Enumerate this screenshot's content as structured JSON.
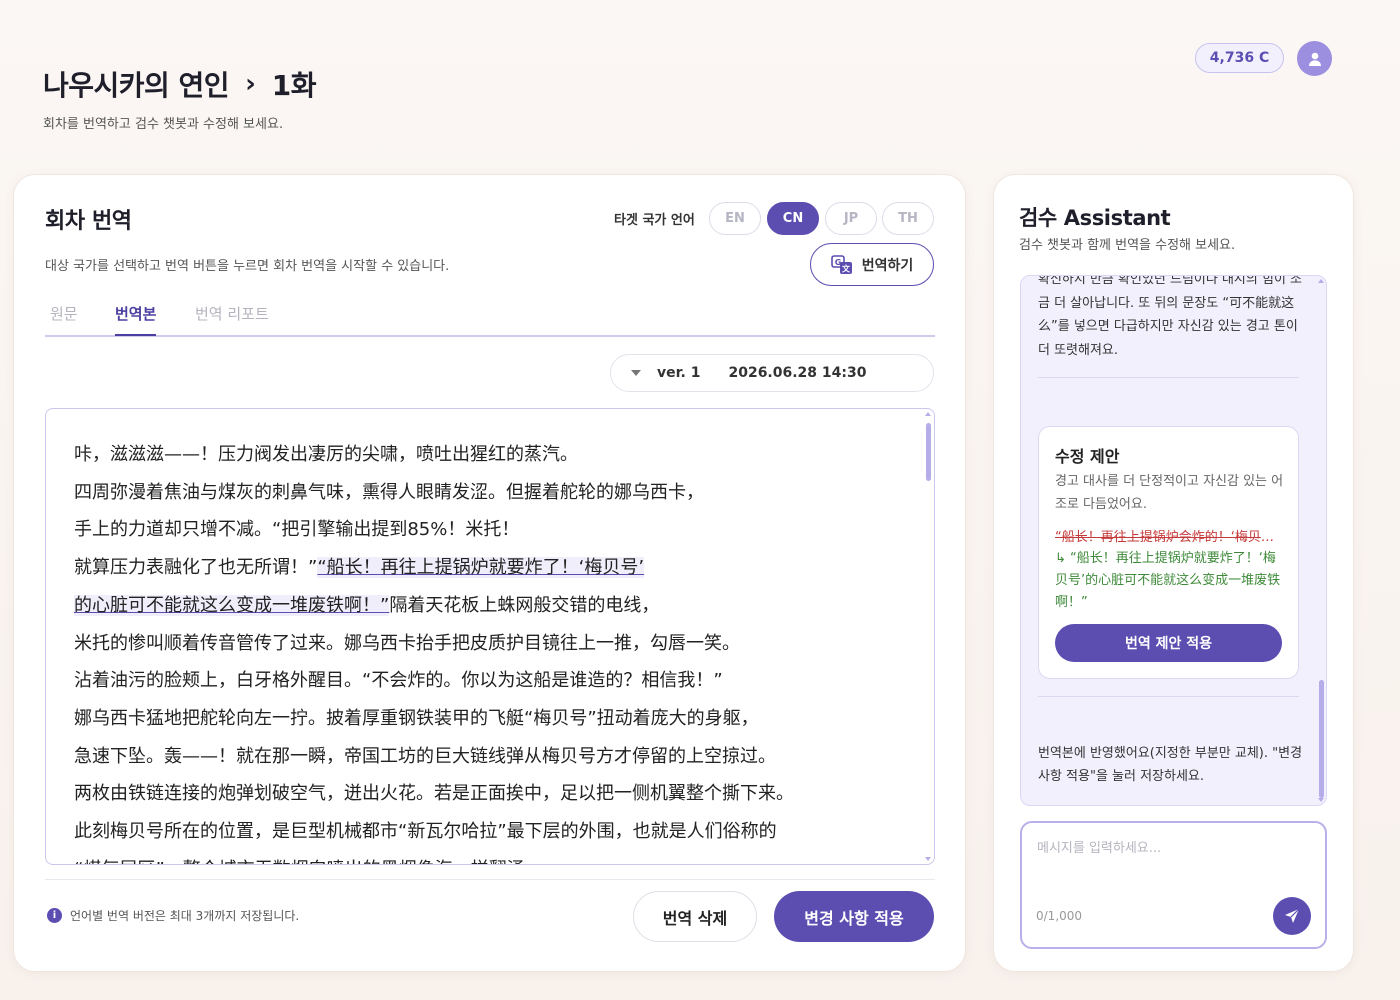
{
  "header": {
    "breadcrumb_work": "나우시카의 연인",
    "breadcrumb_episode": "1화",
    "subtitle": "회차를 번역하고 검수 챗봇과 수정해 보세요.",
    "credits": "4,736 C"
  },
  "translation_panel": {
    "title": "회차 번역",
    "description": "대상 국가를 선택하고 번역 버튼을 누르면 회차 번역을 시작할 수 있습니다.",
    "target_language_label": "타겟 국가 언어",
    "languages": [
      {
        "code": "EN",
        "active": false
      },
      {
        "code": "CN",
        "active": true
      },
      {
        "code": "JP",
        "active": false
      },
      {
        "code": "TH",
        "active": false
      }
    ],
    "translate_button": "번역하기",
    "tabs": [
      {
        "label": "원문",
        "active": false
      },
      {
        "label": "번역본",
        "active": true
      },
      {
        "label": "번역 리포트",
        "active": false
      }
    ],
    "version": {
      "label": "ver. 1",
      "date": "2026.06.28 14:30"
    },
    "text_lines": [
      "咔，滋滋滋——！压力阀发出凄厉的尖啸，喷吐出猩红的蒸汽。",
      "四周弥漫着焦油与煤灰的刺鼻气味，熏得人眼睛发涩。但握着舵轮的娜乌西卡，",
      "手上的力道却只增不减。“把引擎输出提到85%！米托！",
      "就算压力表融化了也无所谓！”",
      "“船长！再往上提锅炉就要炸了！‘梅贝号’",
      "的心脏可不能就这么变成一堆废铁啊！”",
      "隔着天花板上蛛网般交错的电线，",
      "米托的惨叫顺着传音管传了过来。娜乌西卡抬手把皮质护目镜往上一推，勾唇一笑。",
      "沾着油污的脸颊上，白牙格外醒目。“不会炸的。你以为这船是谁造的？相信我！”",
      "娜乌西卡猛地把舵轮向左一拧。披着厚重钢铁装甲的飞艇“梅贝号”扭动着庞大的身躯，",
      "急速下坠。轰——！就在那一瞬，帝国工坊的巨大链线弹从梅贝号方才停留的上空掠过。",
      "两枚由铁链连接的炮弹划破空气，迸出火花。若是正面挨中，足以把一侧机翼整个撕下来。",
      "此刻梅贝号所在的位置，是巨型机械都市“新瓦尔哈拉”最下层的外围，也就是人们俗称的",
      "“煤气层区”。整个城市无数烟囱喷出的黑烟像海一样翻涌"
    ],
    "footer_info": "언어별 번역 버전은 최대 3개까지 저장됩니다.",
    "delete_button": "번역 삭제",
    "apply_button": "변경 사항 적용"
  },
  "assistant": {
    "title": "검수 Assistant",
    "description": "검수 챗봇과 함께 번역을 수정해 보세요.",
    "message_top": "확신하지 만큼 확인있던 드림이다 대시의 힘이 조금 더 살아납니다. 또 뒤의 문장도 “可不能就这么”를 넣으면 다급하지만 자신감 있는 경고 톤이 더 또렷해져요.",
    "suggestion": {
      "title": "수정 제안",
      "description": "경고 대사를 더 단정적이고 자신감 있는 어조로 다듬었어요.",
      "old_text": "“船长！再往上提锅炉会炸的！‘梅贝号’的心脏”",
      "new_text": "↳ “船长！再往上提锅炉就要炸了！‘梅贝号’的心脏可不能就这么变成一堆废铁啊！”",
      "apply_button": "번역 제안 적용"
    },
    "message_bottom": "번역본에 반영했어요(지정한 부분만 교체). \"변경 사항 적용\"을 눌러 저장하세요.",
    "input_placeholder": "메시지를 입력하세요...",
    "counter": "0/1,000"
  }
}
